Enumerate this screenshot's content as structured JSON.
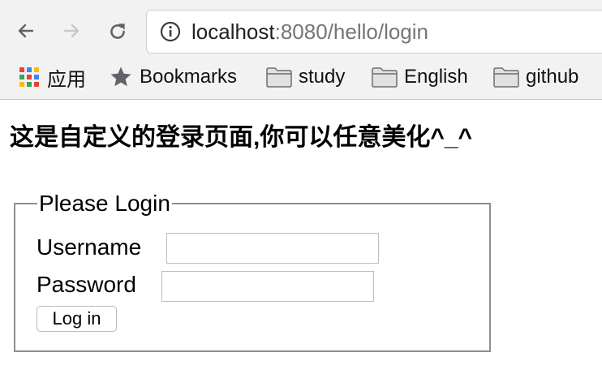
{
  "browser": {
    "address_bar": {
      "host": "localhost",
      "port_and_path": ":8080/hello/login"
    },
    "bookmarks": [
      {
        "label": "应用",
        "icon": "apps-grid-icon"
      },
      {
        "label": "Bookmarks",
        "icon": "star-icon"
      },
      {
        "label": "study",
        "icon": "folder-icon"
      },
      {
        "label": "English",
        "icon": "folder-icon"
      },
      {
        "label": "github",
        "icon": "folder-icon"
      }
    ]
  },
  "page": {
    "title": "这是自定义的登录页面,你可以任意美化^_^",
    "form": {
      "legend": "Please Login",
      "username_label": "Username",
      "username_value": "",
      "password_label": "Password",
      "password_value": "",
      "submit_label": "Log in"
    }
  }
}
